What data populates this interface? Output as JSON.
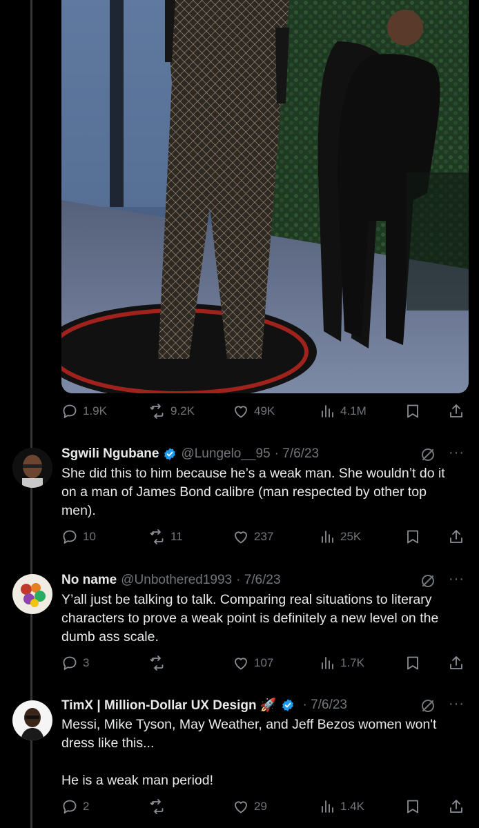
{
  "main_tweet": {
    "stats": {
      "replies": "1.9K",
      "retweets": "9.2K",
      "likes": "49K",
      "views": "4.1M"
    }
  },
  "replies": [
    {
      "name": "Sgwili Ngubane",
      "verified": true,
      "handle": "@Lungelo__95",
      "date": "· 7/6/23",
      "text": "She did this to him because he’s a weak man. She wouldn’t do it on a man of James Bond calibre (man respected by other top men).",
      "stats": {
        "replies": "10",
        "retweets": "11",
        "likes": "237",
        "views": "25K"
      }
    },
    {
      "name": "No name",
      "verified": false,
      "handle": "@Unbothered1993",
      "date": "· 7/6/23",
      "text": "Y’all just be talking to talk. Comparing real situations to literary characters to prove a weak point is definitely a new level on the dumb ass scale.",
      "stats": {
        "replies": "3",
        "retweets": "",
        "likes": "107",
        "views": "1.7K"
      }
    },
    {
      "name": "TimX | Million-Dollar UX Design 🚀",
      "verified": true,
      "handle": "",
      "date": "· 7/6/23",
      "text": "Messi, Mike Tyson, May Weather, and Jeff Bezos women won't dress like this...\n\nHe is a weak man period!",
      "stats": {
        "replies": "2",
        "retweets": "",
        "likes": "29",
        "views": "1.4K"
      }
    }
  ],
  "icons": {
    "reply": "reply-icon",
    "retweet": "retweet-icon",
    "like": "heart-icon",
    "views": "views-icon",
    "bookmark": "bookmark-icon",
    "share": "share-icon",
    "grok": "grok-icon",
    "more": "more-icon",
    "verified": "verified-badge-icon"
  },
  "colors": {
    "background": "#000000",
    "text": "#e7e9ea",
    "muted": "#71767b",
    "verified": "#1d9bf0",
    "divider": "#333639"
  }
}
